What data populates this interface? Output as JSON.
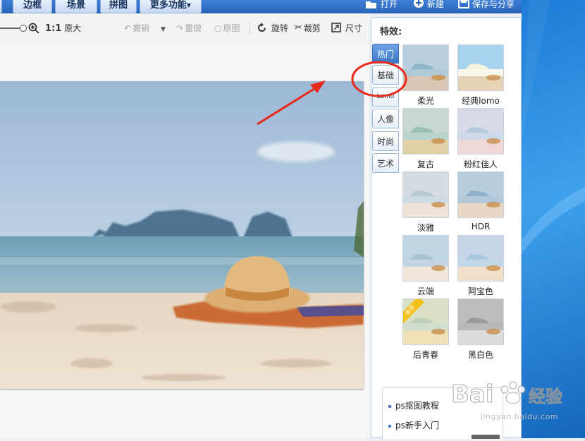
{
  "menu": {
    "tabs": [
      "边框",
      "场景",
      "拼图",
      "更多功能"
    ],
    "actions": {
      "open": "打开",
      "new": "新建",
      "save_share": "保存与分享"
    }
  },
  "toolbar": {
    "actual_size_ratio": "1:1",
    "actual_size_label": "原大",
    "undo": "撤销",
    "redo": "重做",
    "original": "原图",
    "rotate": "旋转",
    "crop": "裁剪",
    "resize": "尺寸"
  },
  "effects": {
    "title": "特效:",
    "tabs": [
      "热门",
      "基础",
      "Lomo",
      "人像",
      "时尚",
      "艺术"
    ],
    "items": [
      {
        "label": "柔光"
      },
      {
        "label": "经典lomo"
      },
      {
        "label": "复古"
      },
      {
        "label": "粉红佳人"
      },
      {
        "label": "淡雅"
      },
      {
        "label": "HDR"
      },
      {
        "label": "云端"
      },
      {
        "label": "阿宝色"
      },
      {
        "label": "后青春",
        "badge": "会员"
      },
      {
        "label": "黑白色"
      }
    ]
  },
  "links": [
    "ps抠图教程",
    "ps新手入门"
  ],
  "watermark": {
    "brand": "Bai",
    "brand_cn": "经验",
    "url": "jingyan.baidu.com"
  },
  "colors": {
    "accent": "#3b78c8",
    "annotation": "#e8291c"
  }
}
